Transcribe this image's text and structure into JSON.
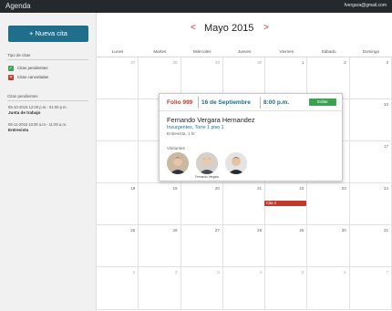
{
  "app": {
    "title": "Agenda",
    "user_email": "fvergara@gmail.com"
  },
  "sidebar": {
    "new_button": "+ Nueva cita",
    "types_title": "Tipo de citas",
    "legend": [
      {
        "label": "Citas pendientes",
        "color": "#3aa251",
        "icon": "check-icon"
      },
      {
        "label": "Citas canceladas",
        "color": "#c0392b",
        "icon": "cross-icon"
      }
    ],
    "pending_title": "Citas pendientes",
    "appointments": [
      {
        "time": "05-10-2015 12:00 p.m.- 01:00 p.m.",
        "name": "Junta de trabajo"
      },
      {
        "time": "05-11-2015 10:00 a.m.- 11:00 a.m.",
        "name": "Entrevista"
      }
    ]
  },
  "calendar": {
    "month_title": "Mayo 2015",
    "prev_icon": "chevron-left-icon",
    "next_icon": "chevron-right-icon",
    "weekdays": [
      "Lunes",
      "Martes",
      "Miércoles",
      "Jueves",
      "Viernes",
      "Sábado",
      "Domingo"
    ],
    "weeks": [
      [
        {
          "d": "27",
          "o": true
        },
        {
          "d": "28",
          "o": true
        },
        {
          "d": "29",
          "o": true
        },
        {
          "d": "30",
          "o": true
        },
        {
          "d": "1",
          "o": false
        },
        {
          "d": "2",
          "o": false
        },
        {
          "d": "3",
          "o": false
        }
      ],
      [
        {
          "d": "",
          "o": false
        },
        {
          "d": "",
          "o": false
        },
        {
          "d": "",
          "o": false
        },
        {
          "d": "",
          "o": false
        },
        {
          "d": "",
          "o": false
        },
        {
          "d": "",
          "o": false
        },
        {
          "d": "10",
          "o": false
        }
      ],
      [
        {
          "d": "",
          "o": false
        },
        {
          "d": "",
          "o": false
        },
        {
          "d": "",
          "o": false
        },
        {
          "d": "",
          "o": false
        },
        {
          "d": "",
          "o": false
        },
        {
          "d": "",
          "o": false
        },
        {
          "d": "17",
          "o": false
        }
      ],
      [
        {
          "d": "18",
          "o": false
        },
        {
          "d": "19",
          "o": false
        },
        {
          "d": "20",
          "o": false
        },
        {
          "d": "21",
          "o": false
        },
        {
          "d": "22",
          "o": false
        },
        {
          "d": "23",
          "o": false
        },
        {
          "d": "24",
          "o": false
        }
      ],
      [
        {
          "d": "25",
          "o": false
        },
        {
          "d": "26",
          "o": false
        },
        {
          "d": "27",
          "o": false
        },
        {
          "d": "28",
          "o": false
        },
        {
          "d": "29",
          "o": false
        },
        {
          "d": "30",
          "o": false
        },
        {
          "d": "31",
          "o": false
        }
      ],
      [
        {
          "d": "1",
          "o": true
        },
        {
          "d": "2",
          "o": true
        },
        {
          "d": "3",
          "o": true
        },
        {
          "d": "4",
          "o": true
        },
        {
          "d": "5",
          "o": true
        },
        {
          "d": "6",
          "o": true
        },
        {
          "d": "7",
          "o": true
        }
      ]
    ],
    "event_chip": "Cita 2"
  },
  "popup": {
    "folio": "Folio 999",
    "date": "16 de Septiembre",
    "time": "8:00 p.m.",
    "edit_button": "Editar",
    "client_name": "Fernando Vergara Hernandez",
    "address": "Insurgentes, Torre 1 piso 1",
    "duration": "Entrevista, 1 hr",
    "visitors_label": "Visitantes",
    "visitors": [
      {
        "name": ""
      },
      {
        "name": "Fernando Vergara"
      },
      {
        "name": ""
      }
    ]
  },
  "colors": {
    "accent": "#1f6e8c",
    "danger": "#c0392b",
    "success": "#3aa251",
    "topbar": "#24292e"
  }
}
